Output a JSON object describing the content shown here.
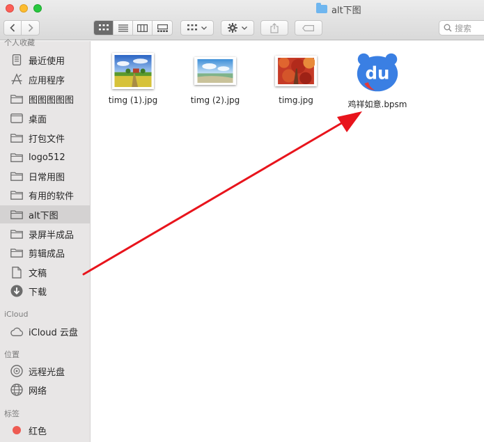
{
  "window": {
    "title": "alt下图"
  },
  "toolbar": {
    "back_label": "‹",
    "forward_label": "›",
    "search_placeholder": "搜索"
  },
  "sidebar": {
    "favorites_header": "个人收藏",
    "favorites": [
      {
        "label": "最近使用",
        "icon": "recents-icon"
      },
      {
        "label": "应用程序",
        "icon": "applications-icon"
      },
      {
        "label": "图图图图图",
        "icon": "folder-icon"
      },
      {
        "label": "桌面",
        "icon": "desktop-icon"
      },
      {
        "label": "打包文件",
        "icon": "folder-icon"
      },
      {
        "label": "logo512",
        "icon": "folder-icon"
      },
      {
        "label": "日常用图",
        "icon": "folder-icon"
      },
      {
        "label": "有用的软件",
        "icon": "folder-icon"
      },
      {
        "label": "alt下图",
        "icon": "folder-icon",
        "selected": true
      },
      {
        "label": "录屏半成品",
        "icon": "folder-icon"
      },
      {
        "label": "剪辑成品",
        "icon": "folder-icon"
      },
      {
        "label": "文稿",
        "icon": "document-icon"
      },
      {
        "label": "下载",
        "icon": "download-icon"
      }
    ],
    "icloud_header": "iCloud",
    "icloud": [
      {
        "label": "iCloud 云盘",
        "icon": "cloud-icon"
      }
    ],
    "locations_header": "位置",
    "locations": [
      {
        "label": "远程光盘",
        "icon": "disc-icon"
      },
      {
        "label": "网络",
        "icon": "network-icon"
      }
    ],
    "tags_header": "标签",
    "tags": [
      {
        "label": "红色",
        "color": "#ee5b52"
      }
    ]
  },
  "files": [
    {
      "name": "timg (1).jpg",
      "icon": "landscape-farm-thumbnail"
    },
    {
      "name": "timg (2).jpg",
      "icon": "landscape-beach-thumbnail"
    },
    {
      "name": "timg.jpg",
      "icon": "autumn-leaves-thumbnail"
    },
    {
      "name": "鸡祥如意.bpsm",
      "icon": "baidu-du-app-icon"
    }
  ],
  "colors": {
    "accent": "#2f7de1",
    "arrow": "#e8141c",
    "sidebar_bg": "#e8e6e6"
  }
}
